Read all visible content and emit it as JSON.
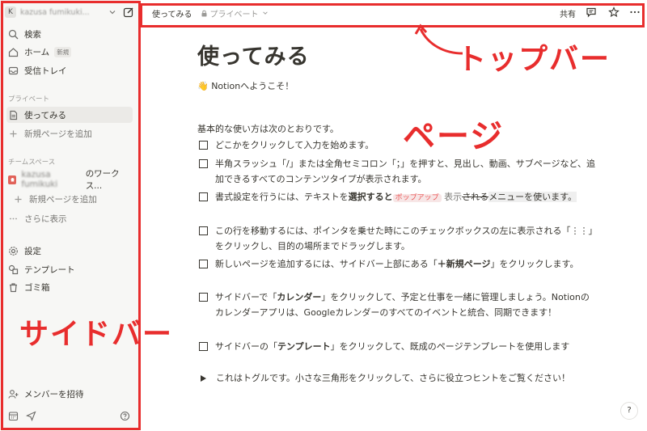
{
  "sidebar": {
    "workspace": {
      "avatar_letter": "K",
      "name": "kazusa fumikuki..."
    },
    "search_label": "検索",
    "home_label": "ホーム",
    "home_badge": "新規",
    "inbox_label": "受信トレイ",
    "private_header": "プライベート",
    "private_page": "使ってみる",
    "private_add": "新規ページを追加",
    "teamspace_header": "チームスペース",
    "team_name": "kazusa fumikuki",
    "team_suffix": "のワークス...",
    "team_add": "新規ページを追加",
    "team_more": "さらに表示",
    "settings_label": "設定",
    "templates_label": "テンプレート",
    "trash_label": "ゴミ箱",
    "invite_label": "メンバーを招待"
  },
  "topbar": {
    "breadcrumb": "使ってみる",
    "privacy": "プライベート",
    "share": "共有"
  },
  "page": {
    "title": "使ってみる",
    "welcome": "👋 Notionへようこそ！",
    "intro": "基本的な使い方は次のとおりです。",
    "todo1": "どこかをクリックして入力を始めます。",
    "todo2": "半角スラッシュ「/」または全角セミコロン「；」を押すと、見出し、動画、サブページなど、追加できるすべてのコンテンツタイプが表示されます。",
    "todo3_a": "書式設定を行うには、テキストを",
    "todo3_b": "選択すると",
    "todo3_c": "ポップアップ",
    "todo3_d": " 表示",
    "todo3_e": "される",
    "todo3_f": "メニューを使います。",
    "todo4": "この行を移動するには、ポインタを乗せた時にこのチェックボックスの左に表示される「⋮⋮」をクリックし、目的の場所までドラッグします。",
    "todo5_a": "新しいページを追加するには、サイドバー上部にある「",
    "todo5_b": "＋新規ページ",
    "todo5_c": "」をクリックします。",
    "todo6_a": "サイドバーで「",
    "todo6_b": "カレンダー",
    "todo6_c": "」をクリックして、予定と仕事を一緒に管理しましょう。Notionのカレンダーアプリは、Googleカレンダーのすべてのイベントと統合、同期できます！",
    "todo7_a": "サイドバーの「",
    "todo7_b": "テンプレート",
    "todo7_c": "」をクリックして、既成のページテンプレートを使用します",
    "toggle": "これはトグルです。小さな三角形をクリックして、さらに役立つヒントをご覧ください！",
    "help": "?"
  },
  "annotations": {
    "topbar_label": "トップバー",
    "page_label": "ページ",
    "sidebar_label": "サイドバー",
    "color": "#e82d2d"
  }
}
